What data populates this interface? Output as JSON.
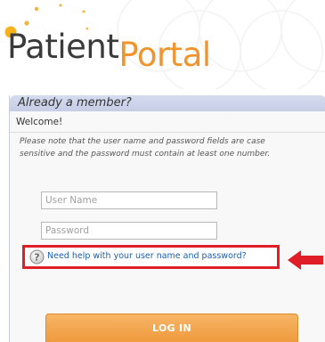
{
  "logo": {
    "word1": "Patient",
    "word2": "Portal",
    "colors": {
      "patient": "#3a3a3a",
      "portal": "#f0952e"
    }
  },
  "login": {
    "header": "Already a member?",
    "welcome": "Welcome!",
    "note_line1": "Please note that the user name and password fields are case",
    "note_line2": "sensitive and the password must contain at least one number.",
    "username_placeholder": "User Name",
    "password_placeholder": "Password",
    "help_icon": "question-circle-icon",
    "help_link": "Need help with your user name and password?",
    "annotation_arrow": "left-arrow-icon",
    "highlight_color": "#e01e28",
    "login_button": "LOG IN",
    "button_color": "#f0a04a"
  }
}
